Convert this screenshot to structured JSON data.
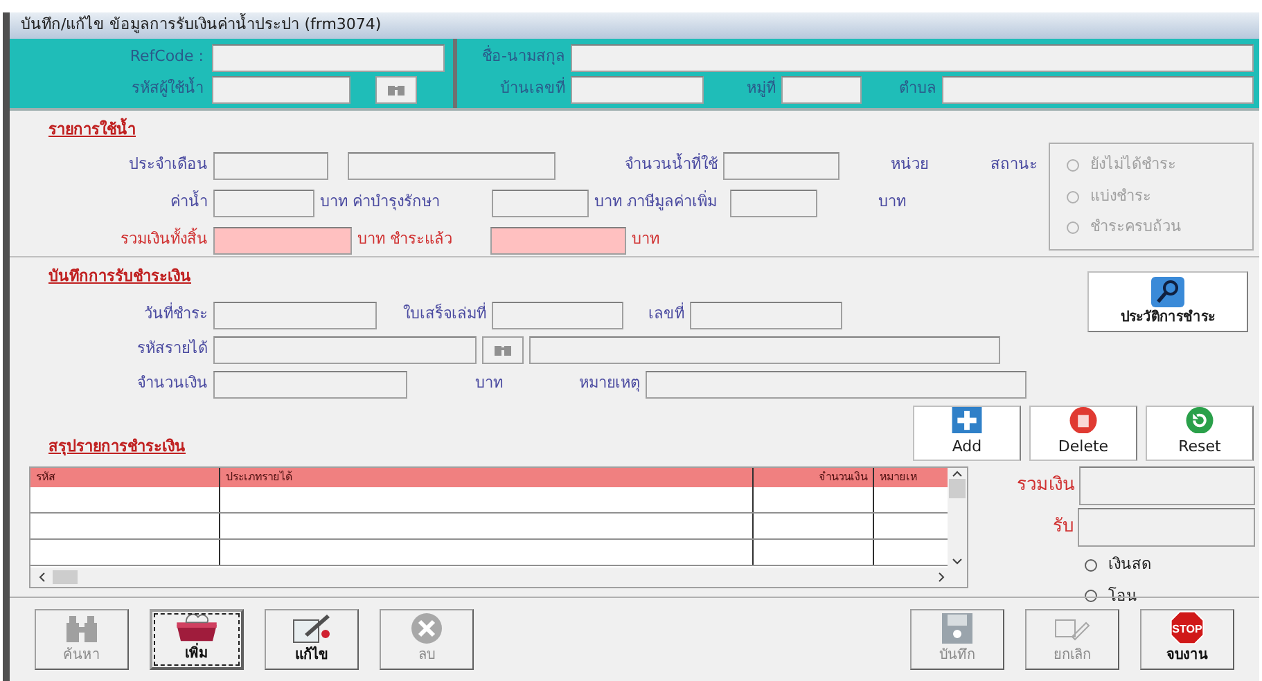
{
  "window": {
    "title": "บันทึก/แก้ไข ข้อมูลการรับเงินค่าน้ำประปา (frm3074)"
  },
  "header": {
    "refcode_label": "RefCode :",
    "user_code_label": "รหัสผู้ใช้น้ำ",
    "name_label": "ชื่อ-นามสกุล",
    "house_no_label": "บ้านเลขที่",
    "village_label": "หมู่ที่",
    "subdistrict_label": "ตำบล"
  },
  "usage": {
    "title": "รายการใช้น้ำ",
    "month_label": "ประจำเดือน",
    "units_used_label": "จำนวนน้ำที่ใช้",
    "unit": "หน่วย",
    "status_label": "สถานะ",
    "water_fee_label": "ค่าน้ำ",
    "maintenance_label": "บาท ค่าบำรุงรักษา",
    "vat_label": "บาท ภาษีมูลค่าเพิ่ม",
    "vat_unit": "บาท",
    "total_label": "รวมเงินทั้งสิ้น",
    "paid_label": "บาท ชำระแล้ว",
    "paid_unit": "บาท",
    "status_options": [
      {
        "label": "ยังไม่ได้ชำระ",
        "selected": false,
        "disabled": true
      },
      {
        "label": "แบ่งชำระ",
        "selected": false,
        "disabled": true
      },
      {
        "label": "ชำระครบถ้วน",
        "selected": false,
        "disabled": true
      }
    ]
  },
  "payment": {
    "title": "บันทึกการรับชำระเงิน",
    "date_label": "วันที่ชำระ",
    "receipt_book_label": "ใบเสร็จเล่มที่",
    "number_label": "เลขที่",
    "income_code_label": "รหัสรายได้",
    "amount_label": "จำนวนเงิน",
    "amount_unit": "บาท",
    "note_label": "หมายเหตุ",
    "history_button": "ประวัติการชำระ",
    "actions": [
      {
        "label": "Add",
        "kind": "add"
      },
      {
        "label": "Delete",
        "kind": "delete"
      },
      {
        "label": "Reset",
        "kind": "reset"
      }
    ]
  },
  "summary": {
    "title": "สรุปรายการชำระเงิน",
    "columns": [
      "รหัส",
      "ประเภทรายได้",
      "จำนวนเงิน",
      "หมายเห"
    ],
    "total_label": "รวมเงิน",
    "received_label": "รับ",
    "methods": [
      {
        "label": "เงินสด",
        "selected": false,
        "disabled": false
      },
      {
        "label": "โอน",
        "selected": false,
        "disabled": false
      }
    ]
  },
  "toolbar": [
    {
      "label": "ค้นหา",
      "kind": "search",
      "disabled": true,
      "focused": false
    },
    {
      "label": "เพิ่ม",
      "kind": "add",
      "disabled": false,
      "focused": true
    },
    {
      "label": "แก้ไข",
      "kind": "edit",
      "disabled": false,
      "focused": false
    },
    {
      "label": "ลบ",
      "kind": "delete",
      "disabled": true,
      "focused": false
    },
    {
      "label": "บันทึก",
      "kind": "save",
      "disabled": true,
      "focused": false
    },
    {
      "label": "ยกเลิก",
      "kind": "cancel",
      "disabled": true,
      "focused": false
    },
    {
      "label": "จบงาน",
      "kind": "stop",
      "disabled": false,
      "focused": false,
      "icon_text": "STOP"
    }
  ]
}
